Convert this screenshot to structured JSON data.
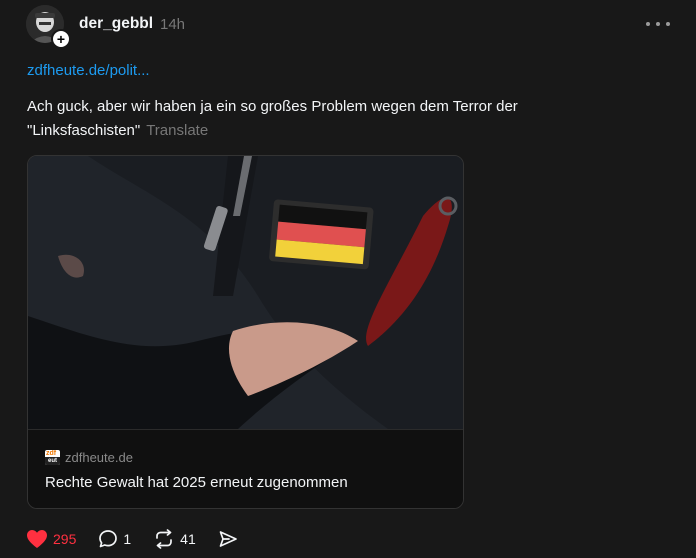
{
  "post": {
    "username": "der_gebbl",
    "timestamp": "14h",
    "link_text": "zdfheute.de/polit...",
    "text": "Ach guck, aber wir haben ja ein so großes Problem wegen dem Terror der \"Linksfaschisten\"",
    "translate_label": "Translate"
  },
  "link_card": {
    "favicon_top": "zdf",
    "favicon_bottom": "eut",
    "source": "zdfheute.de",
    "title": "Rechte Gewalt hat 2025 erneut zugenommen"
  },
  "actions": {
    "likes": "295",
    "replies": "1",
    "reposts": "41"
  },
  "colors": {
    "background": "#181818",
    "link": "#1d9bf0",
    "like": "#ff3040",
    "muted": "#777777"
  },
  "icons": [
    "plus-icon",
    "more-icon",
    "heart-icon",
    "comment-icon",
    "repost-icon",
    "share-icon"
  ]
}
